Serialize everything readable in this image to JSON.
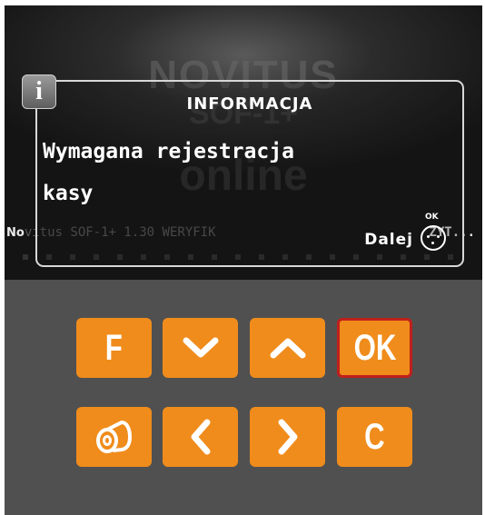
{
  "screen": {
    "brand": "NOVITUS",
    "model": "SOF-1+",
    "edition": "online",
    "status_lead": "No",
    "status_line": "vitus SOF-1+ 1.30 WERYFIK",
    "status_tail": "ZYT...",
    "dialog": {
      "icon": "info-icon",
      "title": "INFORMACJA",
      "message_line1": "Wymagana rejestracja",
      "message_line2": "kasy",
      "next_label": "Dalej",
      "ok_hint": "OK"
    }
  },
  "keypad": {
    "accent_color": "#f08c1c",
    "active_border_color": "#c0201c",
    "keys": {
      "f": "F",
      "down": "chevron-down-icon",
      "up": "chevron-up-icon",
      "ok": "OK",
      "paper": "paper-roll-icon",
      "left": "chevron-left-icon",
      "right": "chevron-right-icon",
      "c": "C"
    }
  }
}
